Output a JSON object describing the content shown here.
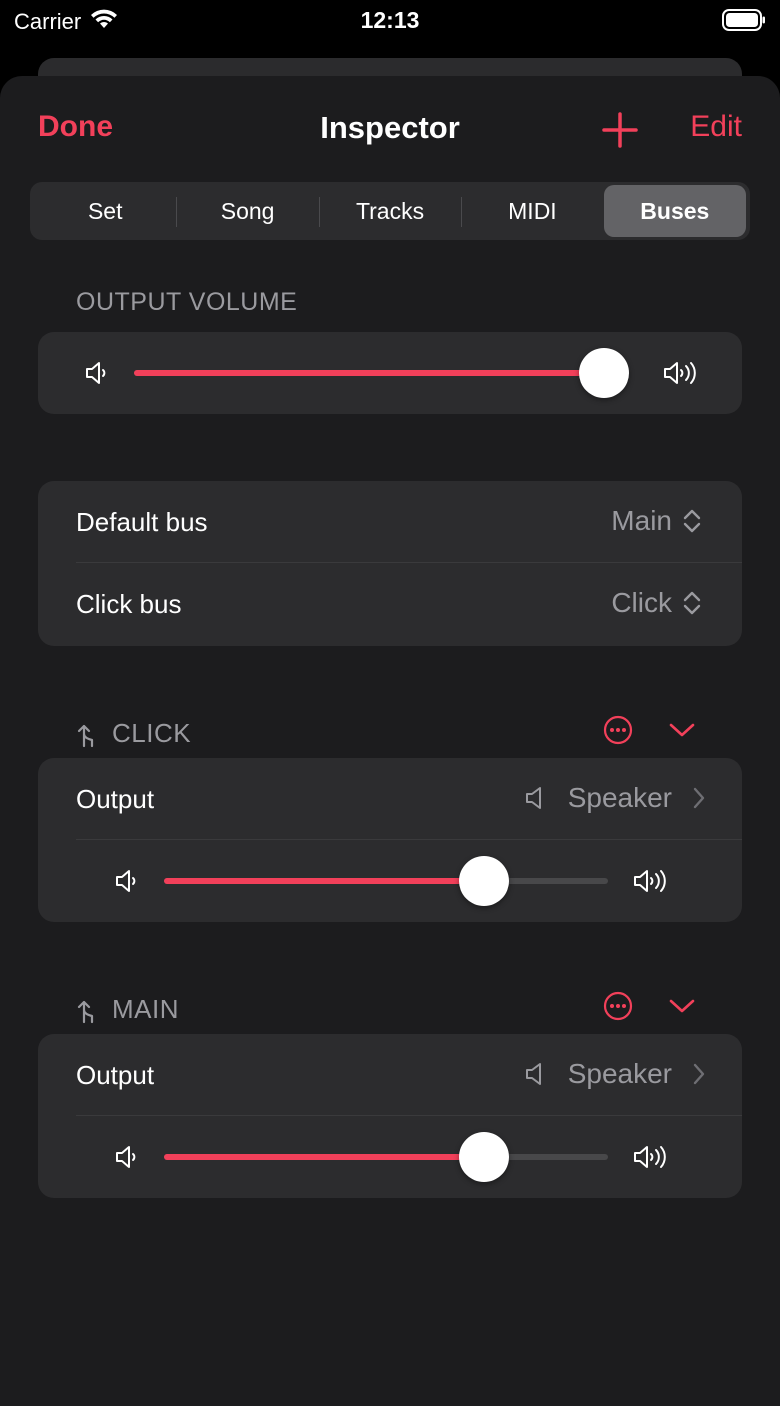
{
  "status": {
    "carrier": "Carrier",
    "time": "12:13"
  },
  "nav": {
    "done": "Done",
    "title": "Inspector",
    "edit": "Edit"
  },
  "tabs": [
    {
      "label": "Set",
      "active": false
    },
    {
      "label": "Song",
      "active": false
    },
    {
      "label": "Tracks",
      "active": false
    },
    {
      "label": "MIDI",
      "active": false
    },
    {
      "label": "Buses",
      "active": true
    }
  ],
  "output_volume": {
    "header": "OUTPUT VOLUME",
    "value": 0.96
  },
  "routing": {
    "default_bus": {
      "label": "Default bus",
      "value": "Main"
    },
    "click_bus": {
      "label": "Click bus",
      "value": "Click"
    }
  },
  "buses": [
    {
      "name": "CLICK",
      "output_label": "Output",
      "output_value": "Speaker",
      "volume": 0.72
    },
    {
      "name": "MAIN",
      "output_label": "Output",
      "output_value": "Speaker",
      "volume": 0.72
    }
  ],
  "colors": {
    "accent": "#f2405a",
    "background": "#1c1c1e",
    "card": "#2c2c2e",
    "secondary_text": "#9a9a9f"
  }
}
